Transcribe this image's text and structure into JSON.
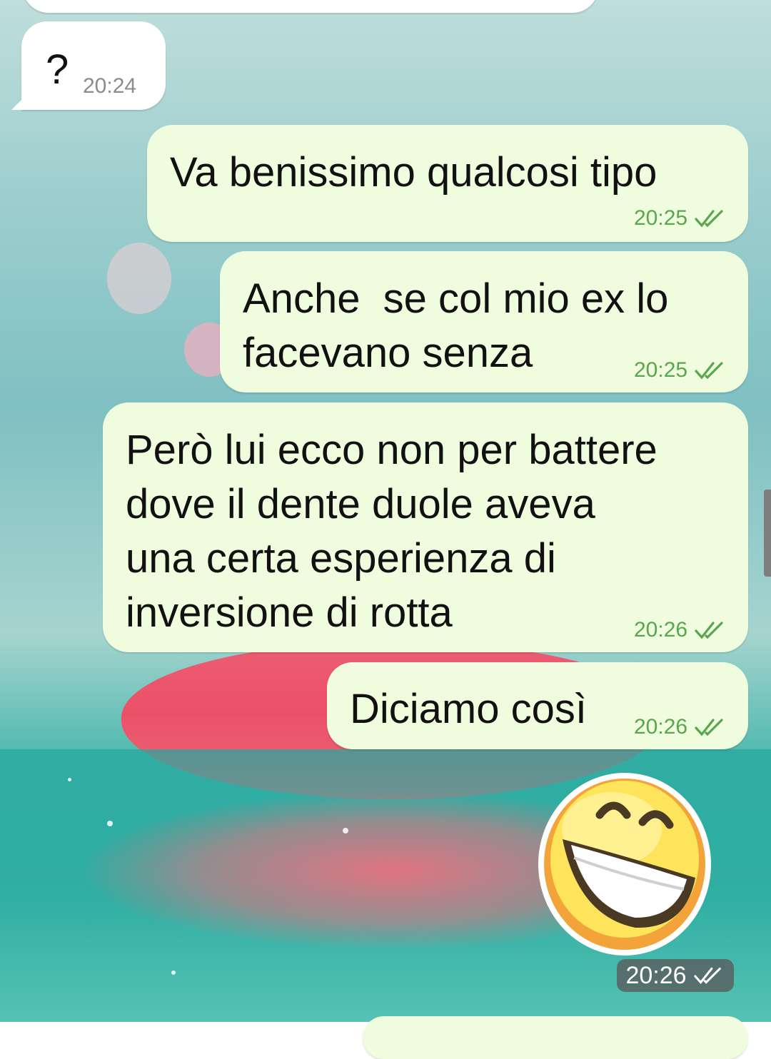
{
  "conversation": {
    "messages": [
      {
        "direction": "incoming",
        "text": "?",
        "time": "20:24"
      },
      {
        "direction": "outgoing",
        "text": "Va benissimo qualcosi tipo",
        "time": "20:25",
        "status": "read"
      },
      {
        "direction": "outgoing",
        "text": "Anche  se col mio ex lo\nfacevano senza",
        "time": "20:25",
        "status": "read"
      },
      {
        "direction": "outgoing",
        "text": "Però lui ecco non per battere\ndove il dente duole aveva\nuna certa esperienza di\ninversione di rotta",
        "time": "20:26",
        "status": "read"
      },
      {
        "direction": "outgoing",
        "text": "Diciamo così",
        "time": "20:26",
        "status": "read"
      }
    ],
    "sticker": {
      "icon": "grinning-face-sticker",
      "time": "20:26",
      "status": "read"
    }
  },
  "theme": {
    "incoming_bubble": "#ffffff",
    "outgoing_bubble": "#effdde",
    "time_outgoing": "#5aa64e",
    "time_incoming": "#8c8c8c"
  }
}
